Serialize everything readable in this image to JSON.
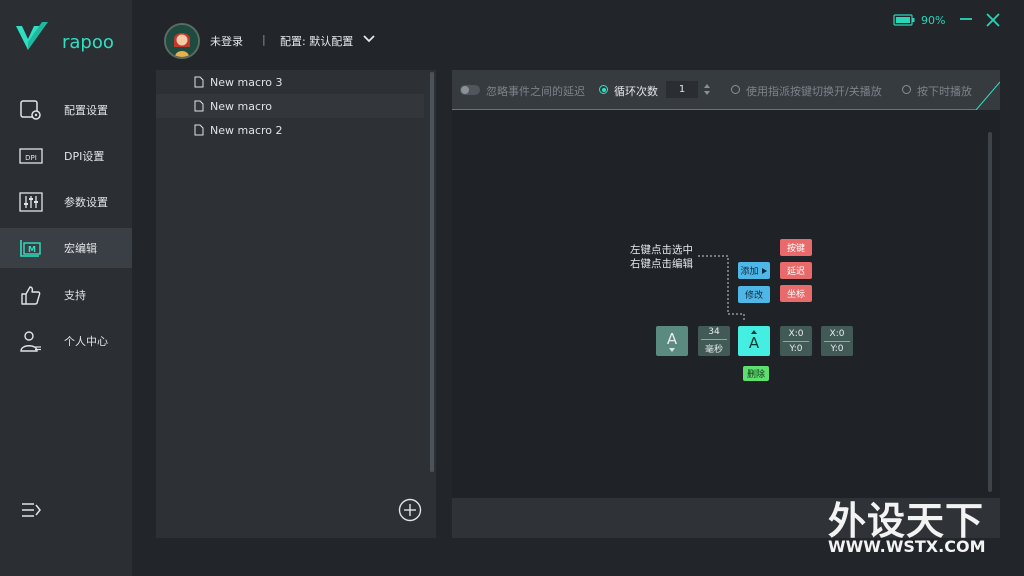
{
  "app": {
    "brand": "rapoo",
    "accent": "#29d6b8"
  },
  "sidebar": {
    "items": [
      {
        "label": "配置设置",
        "icon": "profile-settings-icon",
        "active": false
      },
      {
        "label": "DPI设置",
        "icon": "dpi-icon",
        "active": false
      },
      {
        "label": "参数设置",
        "icon": "sliders-icon",
        "active": false
      },
      {
        "label": "宏编辑",
        "icon": "macro-icon",
        "active": true
      },
      {
        "label": "支持",
        "icon": "thumbs-up-icon",
        "active": false
      },
      {
        "label": "个人中心",
        "icon": "user-icon",
        "active": false
      }
    ]
  },
  "header": {
    "login_status": "未登录",
    "separator": "|",
    "config_label": "配置: 默认配置",
    "battery": "90%"
  },
  "macros": {
    "items": [
      "New macro 3",
      "New macro",
      "New macro 2"
    ]
  },
  "toolbar": {
    "ignore_delay": "忽略事件之间的延迟",
    "loop_count_label": "循环次数",
    "loop_count_value": "1",
    "toggle_play": "使用指派按键切换开/关播放",
    "press_play": "按下时播放"
  },
  "editor": {
    "hint_select": "左键点击选中",
    "hint_edit": "右键点击编辑",
    "add_button": "添加",
    "modify_button": "修改",
    "key_button": "按键",
    "delay_button": "延迟",
    "coord_button": "坐标",
    "delete_button": "删除",
    "tile_key_a": "A",
    "tile_key_a_selected": "A",
    "delay_value": "34",
    "delay_unit": "毫秒",
    "coord1_x": "X:0",
    "coord1_y": "Y:0",
    "coord2_x": "X:0",
    "coord2_y": "Y:0"
  },
  "watermark": {
    "main": "外设天下",
    "sub": "WWW.WSTX.COM"
  }
}
